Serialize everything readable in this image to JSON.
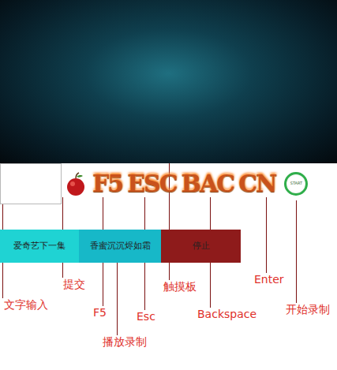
{
  "text_input": {
    "value": ""
  },
  "submit": {
    "icon": "apple"
  },
  "keys": [
    {
      "text": "F5"
    },
    {
      "text": "ESC"
    },
    {
      "text": "BAC"
    },
    {
      "text": "CN"
    }
  ],
  "start": {
    "text": "START"
  },
  "playback_buttons": [
    {
      "label": "爱奇艺下一集",
      "color": "#1fd3d3"
    },
    {
      "label": "香蜜沉沉烬如霜",
      "color": "#17b8c8"
    },
    {
      "label": "停止",
      "color": "#8e1b1b"
    }
  ],
  "annotations": [
    {
      "text": "文字输入"
    },
    {
      "text": "提交"
    },
    {
      "text": "F5"
    },
    {
      "text": "Esc"
    },
    {
      "text": "播放录制"
    },
    {
      "text": "触摸板"
    },
    {
      "text": "Backspace"
    },
    {
      "text": "Enter"
    },
    {
      "text": "开始录制"
    }
  ]
}
